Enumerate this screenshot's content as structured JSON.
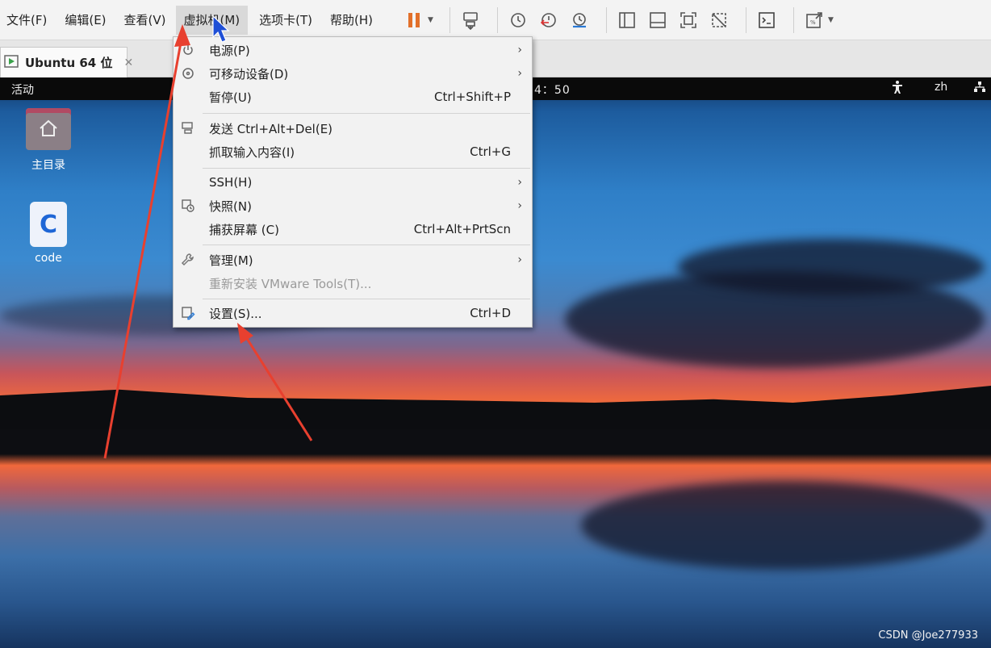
{
  "menubar": {
    "items": [
      "文件(F)",
      "编辑(E)",
      "查看(V)",
      "虚拟机(M)",
      "选项卡(T)",
      "帮助(H)"
    ],
    "active_index": 3
  },
  "toolbar": {
    "icons": [
      "pause-icon",
      "send-keys-icon",
      "snapshot-icon",
      "revert-snapshot-icon",
      "snapshot-manager-icon",
      "show-library-icon",
      "thumbnail-bar-icon",
      "fullscreen-icon",
      "unity-icon",
      "console-view-icon",
      "stretch-guest-icon"
    ],
    "accent_color": "#e2702a"
  },
  "tabs": [
    {
      "label": "Ubuntu 64 位",
      "close": "✕"
    }
  ],
  "guest": {
    "topbar": {
      "activities": "活动",
      "clock": "4：50",
      "language": "zh"
    },
    "desktop_icons": [
      {
        "label": "主目录",
        "icon": "home-folder-icon"
      },
      {
        "label": "code",
        "icon": "code-file-icon"
      }
    ]
  },
  "vm_menu": {
    "items": [
      {
        "label": "电源(P)",
        "shortcut": "",
        "submenu": true,
        "icon": "power-icon",
        "enabled": true
      },
      {
        "label": "可移动设备(D)",
        "shortcut": "",
        "submenu": true,
        "icon": "removable-devices-icon",
        "enabled": true
      },
      {
        "label": "暂停(U)",
        "shortcut": "Ctrl+Shift+P",
        "submenu": false,
        "icon": "",
        "enabled": true
      },
      {
        "label": "发送 Ctrl+Alt+Del(E)",
        "shortcut": "",
        "submenu": false,
        "icon": "send-keys-icon",
        "enabled": true
      },
      {
        "label": "抓取输入内容(I)",
        "shortcut": "Ctrl+G",
        "submenu": false,
        "icon": "",
        "enabled": true
      },
      {
        "label": "SSH(H)",
        "shortcut": "",
        "submenu": true,
        "icon": "",
        "enabled": true
      },
      {
        "label": "快照(N)",
        "shortcut": "",
        "submenu": true,
        "icon": "snapshot-icon",
        "enabled": true
      },
      {
        "label": "捕获屏幕 (C)",
        "shortcut": "Ctrl+Alt+PrtScn",
        "submenu": false,
        "icon": "",
        "enabled": true
      },
      {
        "label": "管理(M)",
        "shortcut": "",
        "submenu": true,
        "icon": "wrench-icon",
        "enabled": true
      },
      {
        "label": "重新安装 VMware Tools(T)...",
        "shortcut": "",
        "submenu": false,
        "icon": "",
        "enabled": false
      },
      {
        "label": "设置(S)...",
        "shortcut": "Ctrl+D",
        "submenu": false,
        "icon": "settings-icon",
        "enabled": true
      }
    ],
    "submenu_glyph": "›"
  },
  "annotation": {
    "arrow_color": "#e8402f"
  },
  "watermark": "CSDN @Joe277933"
}
